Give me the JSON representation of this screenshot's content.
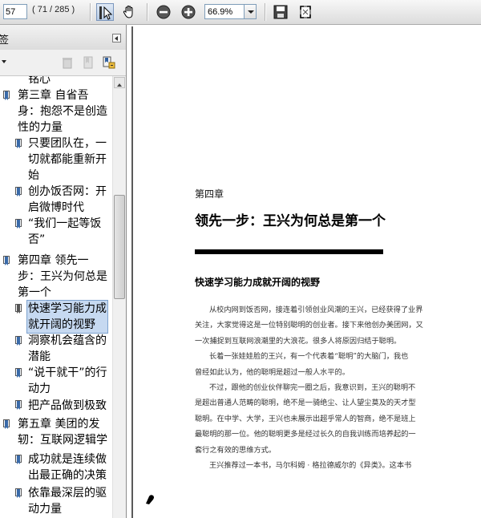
{
  "toolbar": {
    "page_number": "57",
    "page_count": "( 71 / 285 )",
    "zoom": "66.9%",
    "icons": [
      "select-arrow-icon",
      "hand-icon",
      "zoom-out-icon",
      "zoom-in-icon",
      "save-icon",
      "fit-window-icon"
    ]
  },
  "bookmarks_panel": {
    "title": "签",
    "items": [
      {
        "lines": [
          "铭心"
        ]
      },
      {
        "lines": [
          "第三章  自省吾",
          "身：抱怨不是创造",
          "性的力量"
        ]
      },
      {
        "lines": [
          "只要团队在，一",
          "切就都能重新开",
          "始"
        ]
      },
      {
        "lines": [
          "创办饭否网：开",
          "启微博时代"
        ]
      },
      {
        "lines": [
          "“我们一起等饭",
          "否”"
        ]
      },
      {
        "lines": [
          "第四章  领先一",
          "步：王兴为何总是",
          "第一个"
        ]
      },
      {
        "lines": [
          "快速学习能力成",
          "就开阔的视野"
        ]
      },
      {
        "lines": [
          "洞察机会蕴含的",
          "潜能"
        ]
      },
      {
        "lines": [
          "“说干就干”的行",
          "动力"
        ]
      },
      {
        "lines": [
          "把产品做到极致"
        ]
      },
      {
        "lines": [
          "第五章  美团的发",
          "轫：互联网逻辑学"
        ]
      },
      {
        "lines": [
          "成功就是连续做",
          "出最正确的决策"
        ]
      },
      {
        "lines": [
          "依靠最深层的驱",
          "动力量"
        ]
      }
    ]
  },
  "document": {
    "chapter_no": "第四章",
    "chapter_title": "领先一步：王兴为何总是第一个",
    "section_title": "快速学习能力成就开阔的视野",
    "lines": [
      "从校内网到饭否网，接连着引领创业风潮的王兴，已经获得了业界",
      "关注，大家觉得这是一位特别聪明的创业者。接下来他创办美团网，又",
      "一次捕捉到互联网浪潮里的大浪花。很多人将原因归结于聪明。",
      "长着一张娃娃脸的王兴，有一个代表着“聪明”的大脑门，我也",
      "曾经如此认为，他的聪明是超过一般人水平的。",
      "不过，跟他的创业伙伴聊完一圈之后，我意识到，王兴的聪明不",
      "是超出普通人范畴的聪明，绝不是一骑绝尘、让人望尘莫及的天才型",
      "聪明。在中学、大学，王兴也未展示出超乎常人的智商，绝不是班上",
      "最聪明的那一位。他的聪明更多是经过长久的自我训练而培养起的一",
      "套行之有效的思维方式。",
      "王兴推荐过一本书，马尔科姆 · 格拉德威尔的《异类》。这本书"
    ]
  }
}
